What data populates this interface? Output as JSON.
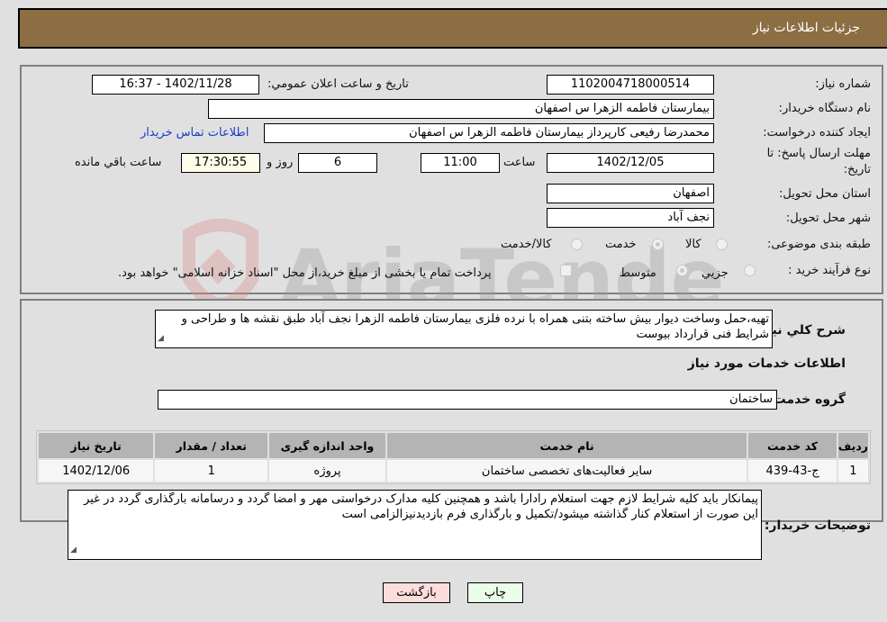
{
  "header": {
    "title": "جزئیات اطلاعات نیاز"
  },
  "fields": {
    "need_number": {
      "label": "شماره نیاز:",
      "value": "1102004718000514"
    },
    "announce_datetime": {
      "label": "تاریخ و ساعت اعلان عمومي:",
      "value": "1402/11/28 - 16:37"
    },
    "buyer_org": {
      "label": "نام دستگاه خریدار:",
      "value": "بیمارستان فاطمه الزهرا س  اصفهان"
    },
    "requester": {
      "label": "ایجاد کننده درخواست:",
      "value": "محمدرضا رفیعی کارپرداز بیمارستان فاطمه الزهرا س  اصفهان"
    },
    "buyer_contact_link": "اطلاعات تماس خریدار",
    "deadline": {
      "label_line1": "مهلت ارسال پاسخ: تا",
      "label_line2": "تاریخ:",
      "date": "1402/12/05",
      "time_label": "ساعت",
      "time": "11:00",
      "days": "6",
      "days_label": "روز و",
      "remaining": "17:30:55",
      "remaining_label": "ساعت باقي مانده"
    },
    "province": {
      "label": "استان محل تحویل:",
      "value": "اصفهان"
    },
    "city": {
      "label": "شهر محل تحویل:",
      "value": "نجف آباد"
    },
    "category": {
      "label": "طبقه بندی موضوعی:",
      "options": [
        {
          "label": "کالا",
          "selected": false
        },
        {
          "label": "خدمت",
          "selected": true
        },
        {
          "label": "کالا/خدمت",
          "selected": false
        }
      ]
    },
    "purchase_type": {
      "label": "نوع فرآیند خرید :",
      "options": [
        {
          "label": "جزیي",
          "selected": false
        },
        {
          "label": "متوسط",
          "selected": true
        }
      ],
      "treasury_checkbox_label": "پرداخت تمام یا بخشی از مبلغ خرید،از محل \"اسناد خزانه اسلامی\" خواهد بود.",
      "treasury_checked": false
    }
  },
  "description": {
    "label": "شرح کلي نیاز:",
    "value": "تهیه،حمل وساخت دیوار بیش ساخته بتنی همراه با نرده فلزی بیمارستان فاطمه الزهرا نجف آباد طبق نقشه ها و طراحی و شرایط فنی قرارداد بیوست"
  },
  "services_section": {
    "title": "اطلاعات خدمات مورد نیاز",
    "group_label": "گروه خدمت:",
    "group_value": "ساختمان",
    "table": {
      "columns": [
        "ردیف",
        "کد خدمت",
        "نام خدمت",
        "واحد اندازه گیری",
        "تعداد / مقدار",
        "تاریخ نیاز"
      ],
      "rows": [
        [
          "1",
          "ج-43-439",
          "سایر فعالیت‌های تخصصی ساختمان",
          "پروژه",
          "1",
          "1402/12/06"
        ]
      ]
    }
  },
  "buyer_notes": {
    "label": "توضیحات خریدار:",
    "value": "پیمانکار باید کلیه شرایط لازم جهت استعلام رادارا باشد و همچنین کلیه مدارک درخواستی مهر و امضا گردد و درسامانه بارگذاری گردد در غیر این صورت از استعلام کنار گذاشته میشود/تکمیل و بارگذاری فرم بازدیدنیزالزامی است"
  },
  "buttons": {
    "print": "چاپ",
    "back": "بازگشت"
  },
  "watermark": {
    "text": "AriaTender.neT"
  }
}
